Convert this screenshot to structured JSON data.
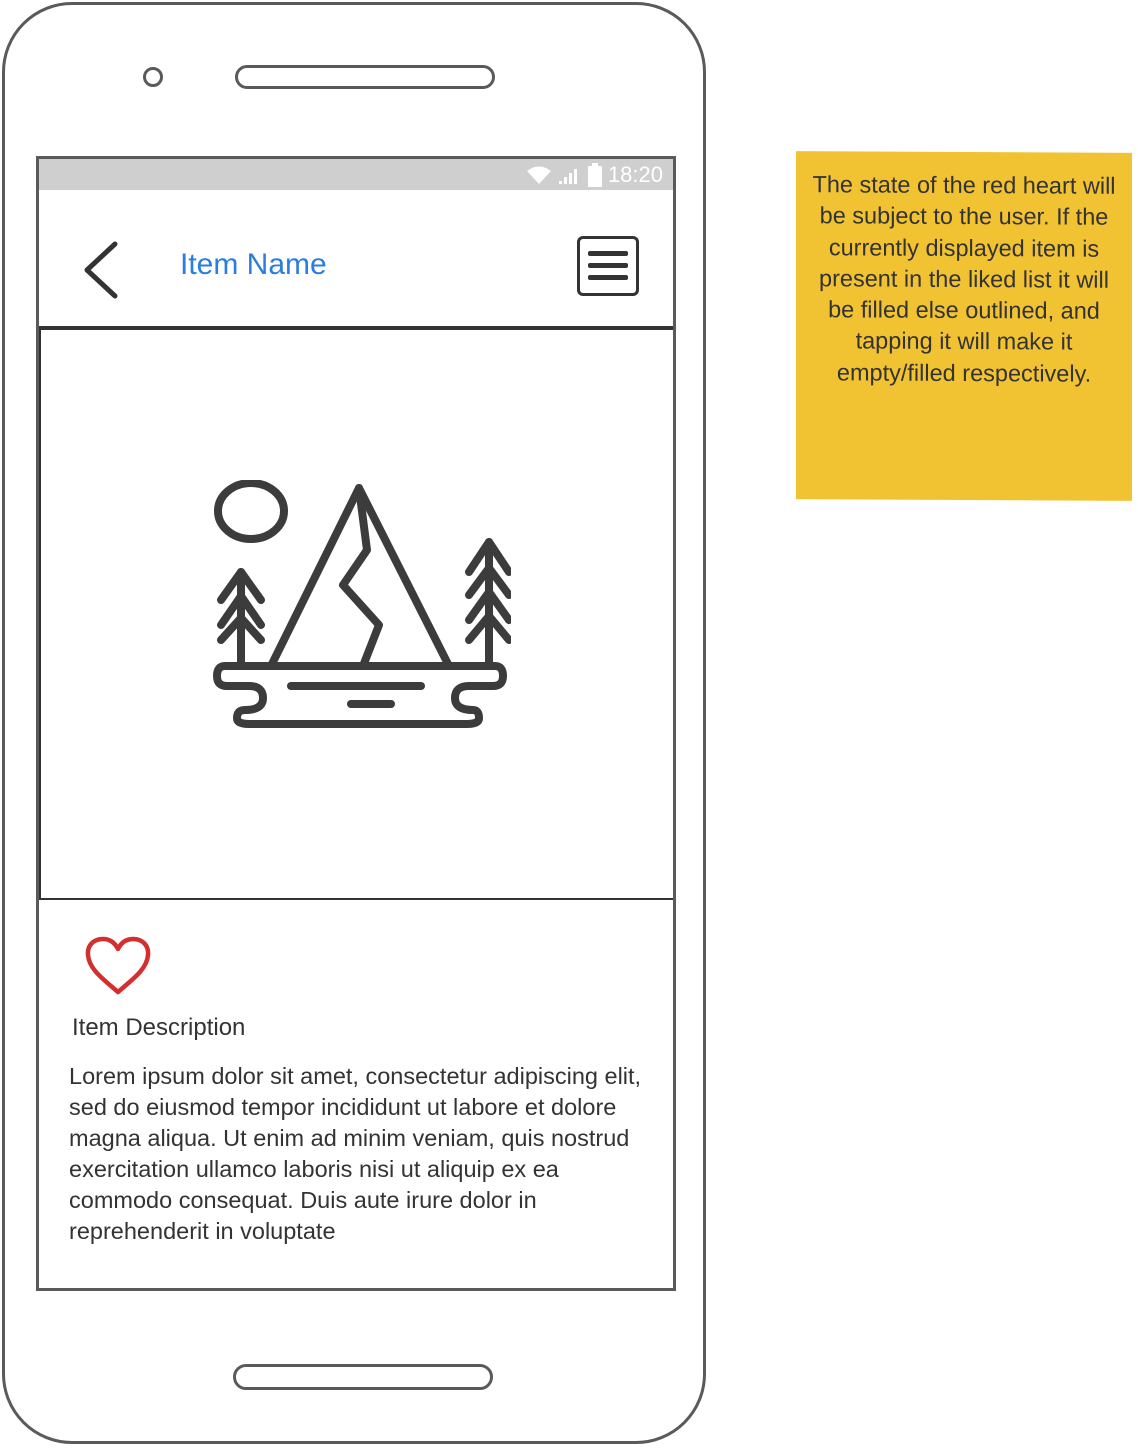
{
  "status_bar": {
    "time": "18:20",
    "icons": [
      "wifi-icon",
      "signal-icon",
      "battery-icon"
    ]
  },
  "app_bar": {
    "title": "Item Name",
    "back_icon": "chevron-left-icon",
    "menu_icon": "hamburger-menu-icon"
  },
  "item_image": {
    "icon": "landscape-image-placeholder-icon"
  },
  "like": {
    "icon": "heart-outline-icon",
    "state": "outlined",
    "color": "#d32f2f"
  },
  "description": {
    "heading": "Item Description",
    "body": "Lorem ipsum dolor sit amet, consectetur adipiscing elit, sed do eiusmod tempor incididunt ut labore et dolore magna aliqua. Ut enim ad minim veniam, quis nostrud exercitation ullamco laboris nisi ut aliquip ex ea commodo consequat. Duis aute irure dolor in reprehenderit in voluptate"
  },
  "annotation": {
    "text": "The state of the red heart will be subject to the user. If the currently displayed item is present in the liked list it will be filled else outlined, and tapping it will make it empty/filled respectively.",
    "color": "#f1c232"
  },
  "colors": {
    "title_accent": "#2a7de1",
    "frame": "#5a5a5a",
    "status_bar_bg": "#cfcfcf"
  }
}
